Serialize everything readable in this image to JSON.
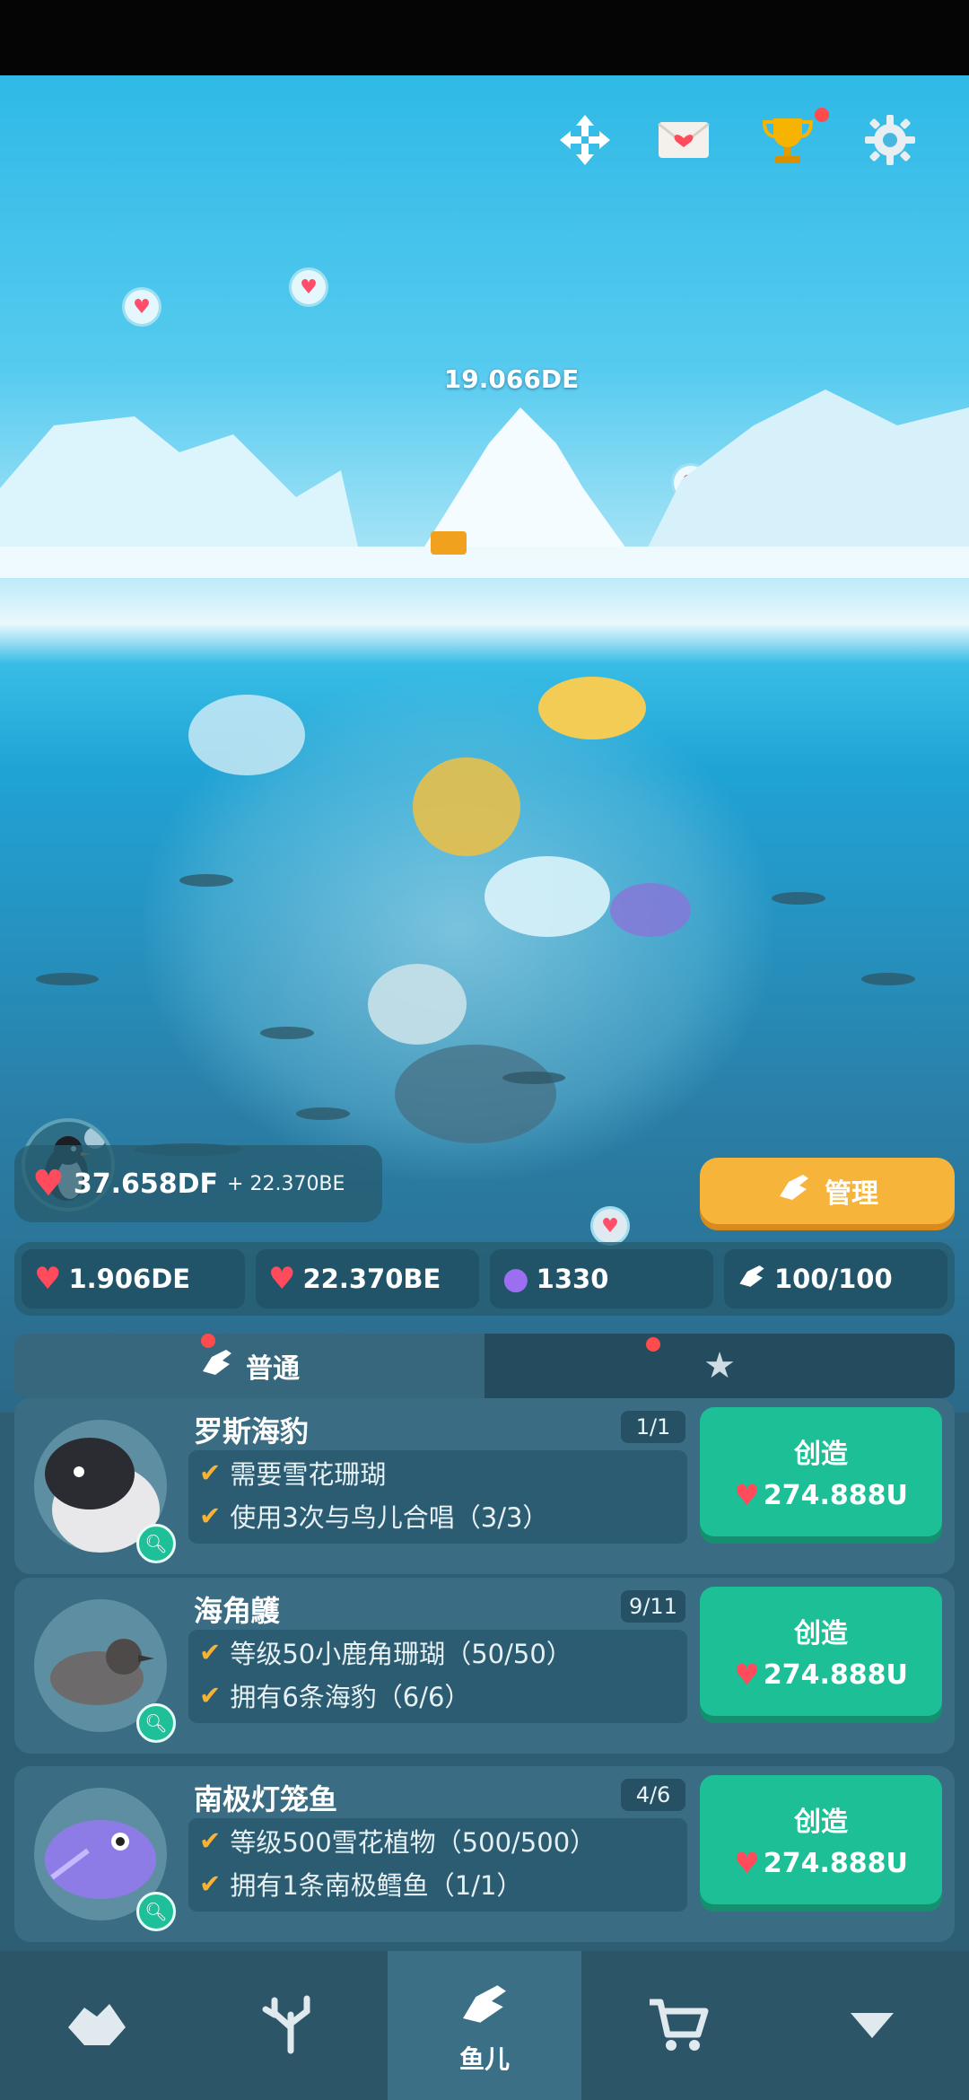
{
  "top_bar": {
    "icons": [
      "move-arrows-icon",
      "mail-heart-icon",
      "trophy-icon",
      "gear-icon"
    ]
  },
  "scene": {
    "iceberg_value": "19.066DE"
  },
  "resources": {
    "hearts_total": "37.658DF",
    "hearts_rate": "+ 22.370BE",
    "manage_label": "管理"
  },
  "stats": {
    "tap_hearts": "1.906DE",
    "timed_hearts": "22.370BE",
    "pearls": "1330",
    "fish_capacity": "100/100"
  },
  "tabs": {
    "normal_label": "普通",
    "favorite_icon": "star-icon"
  },
  "creatures": [
    {
      "name": "罗斯海豹",
      "count": "1/1",
      "req1": "需要雪花珊瑚",
      "req2": "使用3次与鸟儿合唱（3/3）",
      "create_label": "创造",
      "price": "274.888U"
    },
    {
      "name": "海角鸌",
      "count": "9/11",
      "req1": "等级50小鹿角珊瑚（50/50）",
      "req2": "拥有6条海豹（6/6）",
      "create_label": "创造",
      "price": "274.888U"
    },
    {
      "name": "南极灯笼鱼",
      "count": "4/6",
      "req1": "等级500雪花植物（500/500）",
      "req2": "拥有1条南极鳕鱼（1/1）",
      "create_label": "创造",
      "price": "274.888U"
    }
  ],
  "bottom_nav": {
    "active_label": "鱼儿",
    "items": [
      "iceberg-icon",
      "coral-icon",
      "fish-icon",
      "cart-icon",
      "collapse-arrow-icon"
    ]
  },
  "colors": {
    "accent_orange": "#f7b43b",
    "create_green": "#1cbf96",
    "heart_red": "#ff4b5c",
    "check_yellow": "#f9b233"
  }
}
